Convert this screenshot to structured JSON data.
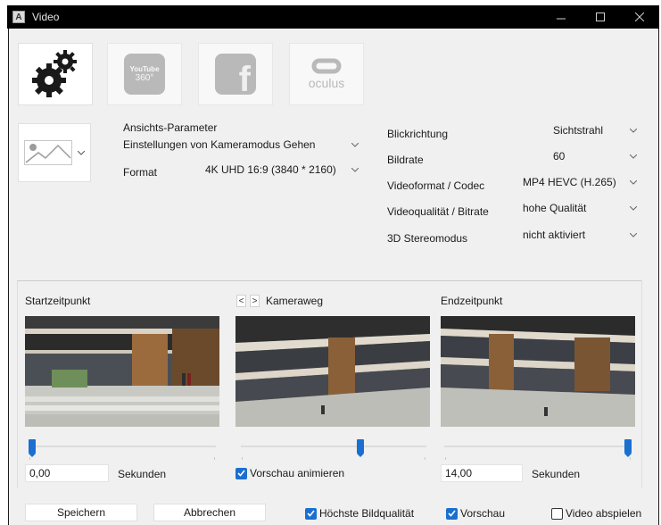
{
  "window": {
    "title": "Video",
    "app_icon_letter": "A",
    "controls": [
      "minimize-icon",
      "maximize-icon",
      "close-icon"
    ]
  },
  "tiles": [
    {
      "name": "settings",
      "icon": "gears-icon",
      "enabled": true
    },
    {
      "name": "youtube-360",
      "icon": "youtube-360-icon",
      "text_top": "YouTube",
      "text_bottom": "360°",
      "enabled": false
    },
    {
      "name": "facebook",
      "icon": "facebook-icon",
      "text": "f",
      "enabled": false
    },
    {
      "name": "oculus",
      "icon": "oculus-icon",
      "text": "oculus",
      "enabled": false
    }
  ],
  "view": {
    "params_label": "Ansichts-Parameter",
    "params_value": "Einstellungen von Kameramodus Gehen",
    "format_label": "Format",
    "format_value": "4K UHD 16:9 (3840 * 2160)"
  },
  "settings": [
    {
      "label": "Blickrichtung",
      "value": "Sichtstrahl"
    },
    {
      "label": "Bildrate",
      "value": "60"
    },
    {
      "label": "Videoformat / Codec",
      "value": "MP4 HEVC (H.265)"
    },
    {
      "label": "Videoqualität / Bitrate",
      "value": "hohe Qualität"
    },
    {
      "label": "3D Stereomodus",
      "value": "nicht aktiviert"
    }
  ],
  "timeline": {
    "start_label": "Startzeitpunkt",
    "camera_label": "Kameraweg",
    "end_label": "Endzeitpunkt",
    "nav_prev": "<",
    "nav_next": ">",
    "start_value": "0,00",
    "end_value": "14,00",
    "unit": "Sekunden",
    "start_slider": 0.0,
    "camera_slider": 0.65,
    "end_slider": 1.0,
    "animate_label": "Vorschau animieren",
    "animate_checked": true
  },
  "footer": {
    "save": "Speichern",
    "cancel": "Abbrechen",
    "quality_label": "Höchste Bildqualität",
    "quality_checked": true,
    "preview_label": "Vorschau",
    "preview_checked": true,
    "play_label": "Video abspielen",
    "play_checked": false
  },
  "colors": {
    "accent": "#1a6fd1",
    "titlebar": "#000000",
    "dialog_bg": "#f0f0f0"
  }
}
